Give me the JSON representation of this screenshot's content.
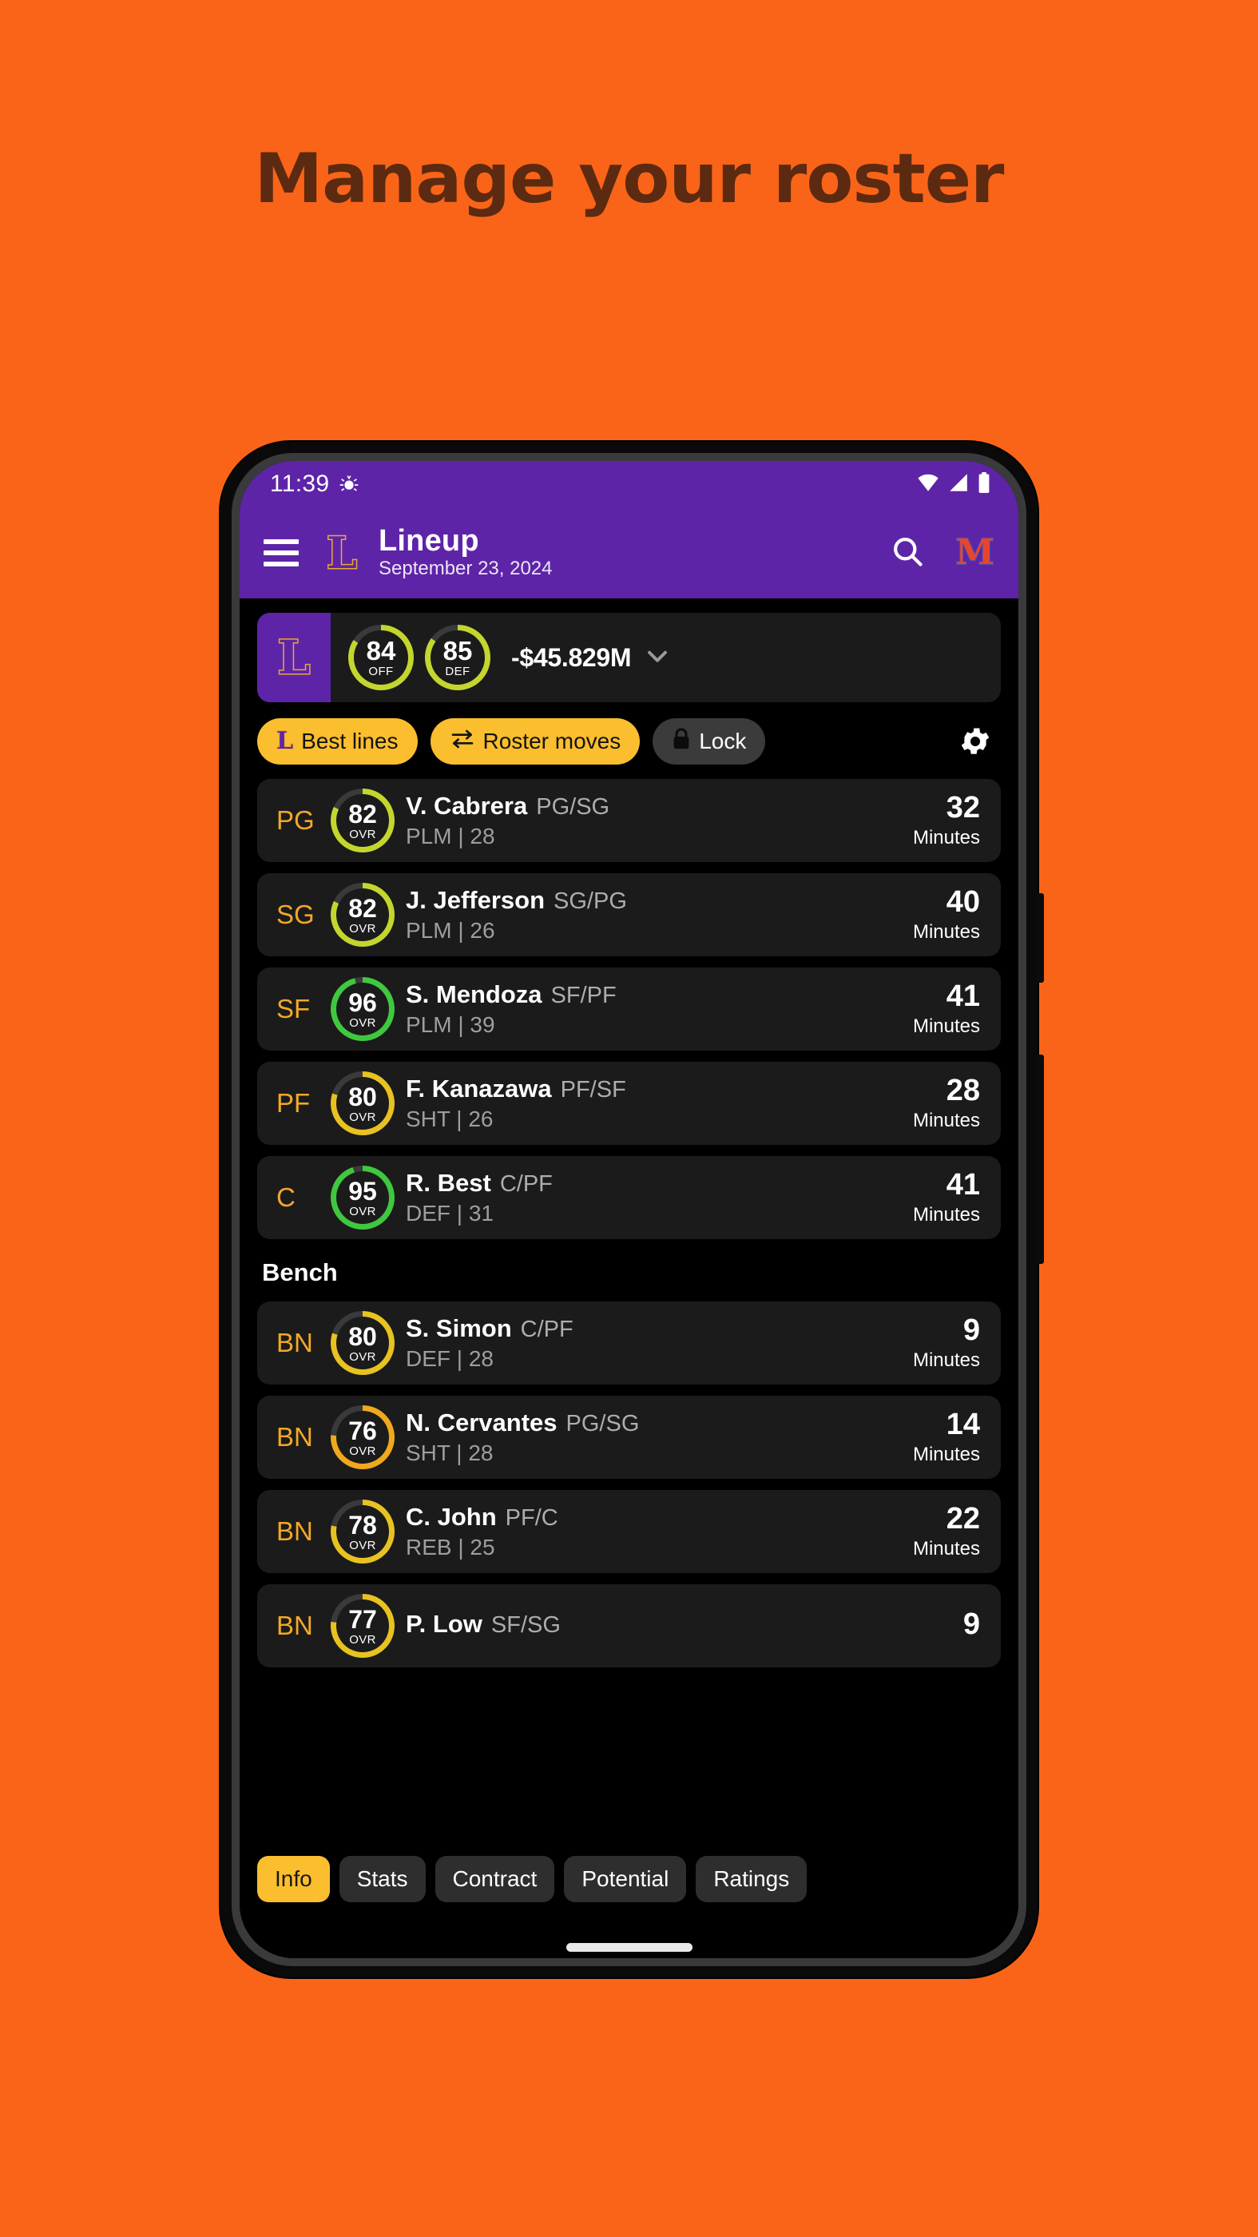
{
  "promo": {
    "heading": "Manage your roster"
  },
  "colors": {
    "background": "#FA6418",
    "heading_text": "#5C2A10",
    "appbar": "#5E24A8",
    "accent_amber": "#FBBE2E",
    "position_amber": "#F2A828",
    "card": "#1B1B1B",
    "ring_green": "#3FC83F",
    "ring_yellowgreen": "#C4D62E",
    "ring_gold": "#E8C220",
    "ring_amber": "#F0A81E",
    "ring_track": "#3A3A3A"
  },
  "status_bar": {
    "time": "11:39",
    "icons": [
      "bug-icon",
      "wifi-icon",
      "cellular-signal-icon",
      "battery-icon"
    ]
  },
  "app_bar": {
    "menu_icon": "hamburger-menu-icon",
    "team_logo": "L",
    "title": "Lineup",
    "subtitle": "September 23, 2024",
    "search_icon": "search-icon",
    "right_logo": "M"
  },
  "team_summary": {
    "logo": "L",
    "ratings": [
      {
        "value": "84",
        "label": "OFF",
        "pct": 84,
        "color": "#C4D62E"
      },
      {
        "value": "85",
        "label": "DEF",
        "pct": 85,
        "color": "#C4D62E"
      }
    ],
    "cap_space": "-$45.829M",
    "expand_icon": "chevron-down-icon"
  },
  "actions": {
    "chips": [
      {
        "label": "Best lines",
        "icon": "team-logo-icon",
        "style": "amber"
      },
      {
        "label": "Roster moves",
        "icon": "swap-arrows-icon",
        "style": "amber"
      },
      {
        "label": "Lock",
        "icon": "lock-icon",
        "style": "dark"
      }
    ],
    "settings_icon": "gear-icon"
  },
  "starters": [
    {
      "slot": "PG",
      "ovr": "82",
      "pct": 82,
      "ring_color": "#C4D62E",
      "name": "V. Cabrera",
      "positions": "PG/SG",
      "meta": "PLM | 28",
      "minutes": "32",
      "minutes_label": "Minutes"
    },
    {
      "slot": "SG",
      "ovr": "82",
      "pct": 82,
      "ring_color": "#C4D62E",
      "name": "J. Jefferson",
      "positions": "SG/PG",
      "meta": "PLM | 26",
      "minutes": "40",
      "minutes_label": "Minutes"
    },
    {
      "slot": "SF",
      "ovr": "96",
      "pct": 96,
      "ring_color": "#3FC83F",
      "name": "S. Mendoza",
      "positions": "SF/PF",
      "meta": "PLM | 39",
      "minutes": "41",
      "minutes_label": "Minutes"
    },
    {
      "slot": "PF",
      "ovr": "80",
      "pct": 80,
      "ring_color": "#E8C220",
      "name": "F. Kanazawa",
      "positions": "PF/SF",
      "meta": "SHT | 26",
      "minutes": "28",
      "minutes_label": "Minutes"
    },
    {
      "slot": "C",
      "ovr": "95",
      "pct": 95,
      "ring_color": "#3FC83F",
      "name": "R. Best",
      "positions": "C/PF",
      "meta": "DEF | 31",
      "minutes": "41",
      "minutes_label": "Minutes"
    }
  ],
  "bench_header": "Bench",
  "bench": [
    {
      "slot": "BN",
      "ovr": "80",
      "pct": 80,
      "ring_color": "#E8C220",
      "name": "S. Simon",
      "positions": "C/PF",
      "meta": "DEF | 28",
      "minutes": "9",
      "minutes_label": "Minutes"
    },
    {
      "slot": "BN",
      "ovr": "76",
      "pct": 76,
      "ring_color": "#F0A81E",
      "name": "N. Cervantes",
      "positions": "PG/SG",
      "meta": "SHT | 28",
      "minutes": "14",
      "minutes_label": "Minutes"
    },
    {
      "slot": "BN",
      "ovr": "78",
      "pct": 78,
      "ring_color": "#E8C220",
      "name": "C. John",
      "positions": "PF/C",
      "meta": "REB | 25",
      "minutes": "22",
      "minutes_label": "Minutes"
    },
    {
      "slot": "BN",
      "ovr": "77",
      "pct": 77,
      "ring_color": "#E8C220",
      "name": "P. Low",
      "positions": "SF/SG",
      "meta": "",
      "minutes": "9",
      "minutes_label": ""
    }
  ],
  "tabs": [
    {
      "label": "Info",
      "active": true
    },
    {
      "label": "Stats",
      "active": false
    },
    {
      "label": "Contract",
      "active": false
    },
    {
      "label": "Potential",
      "active": false
    },
    {
      "label": "Ratings",
      "active": false
    }
  ]
}
